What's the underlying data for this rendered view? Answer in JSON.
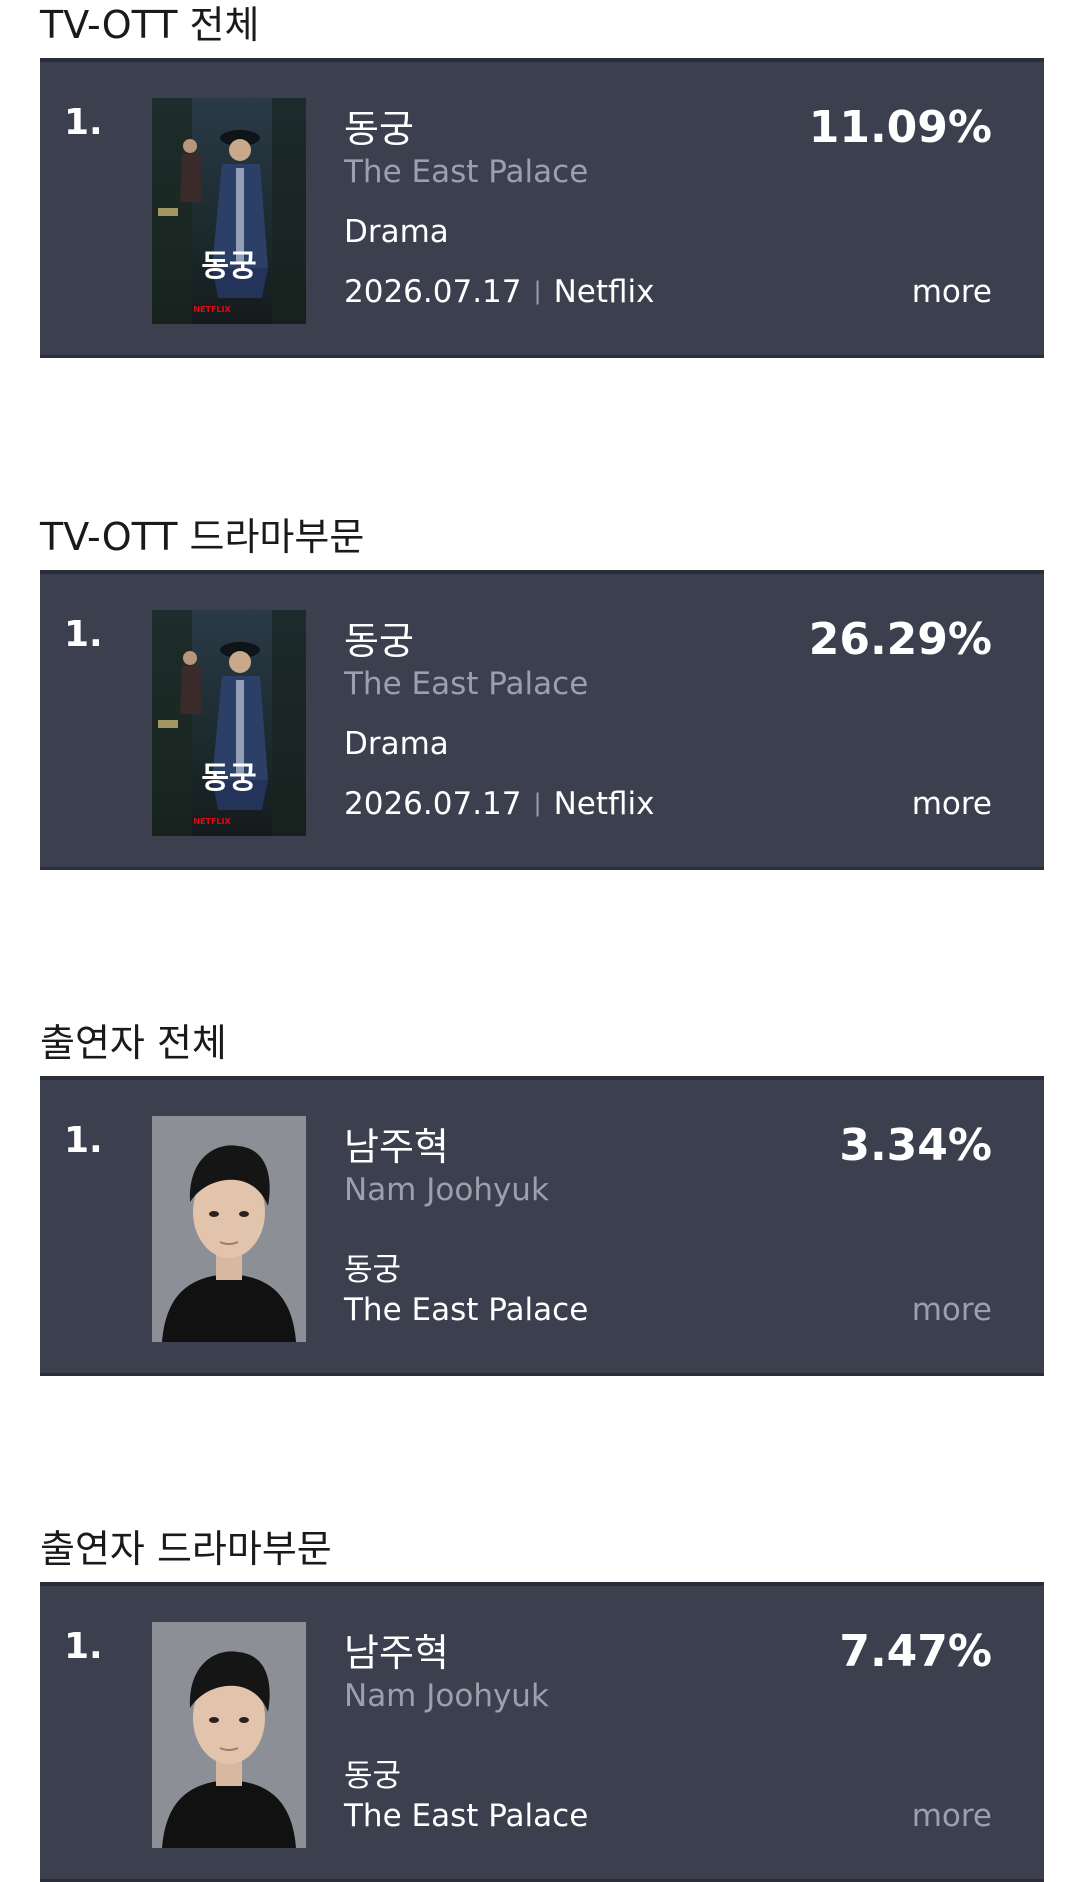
{
  "sections": [
    {
      "title": "TV-OTT 전체",
      "rank": "1.",
      "thumbnail": "poster-image",
      "title_ko": "동궁",
      "title_en": "The East Palace",
      "genre": "Drama",
      "date": "2026.07.17",
      "separator": "|",
      "platform": "Netflix",
      "percent": "11.09%",
      "more_label": "more"
    },
    {
      "title": "TV-OTT 드라마부문",
      "rank": "1.",
      "thumbnail": "poster-image",
      "title_ko": "동궁",
      "title_en": "The East Palace",
      "genre": "Drama",
      "date": "2026.07.17",
      "separator": "|",
      "platform": "Netflix",
      "percent": "26.29%",
      "more_label": "more"
    },
    {
      "title": "출연자 전체",
      "rank": "1.",
      "thumbnail": "portrait-image",
      "name_ko": "남주혁",
      "name_en": "Nam Joohyuk",
      "show_ko": "동궁",
      "show_en": "The East Palace",
      "percent": "3.34%",
      "more_label": "more"
    },
    {
      "title": "출연자 드라마부문",
      "rank": "1.",
      "thumbnail": "portrait-image",
      "name_ko": "남주혁",
      "name_en": "Nam Joohyuk",
      "show_ko": "동궁",
      "show_en": "The East Palace",
      "percent": "7.47%",
      "more_label": "more"
    }
  ],
  "poster": {
    "title_text": "동궁",
    "brand_text": "NETFLIX"
  },
  "colors": {
    "card_bg": "#3b3f4e",
    "muted_text": "#9aa0ad",
    "netflix_red": "#e50914"
  }
}
